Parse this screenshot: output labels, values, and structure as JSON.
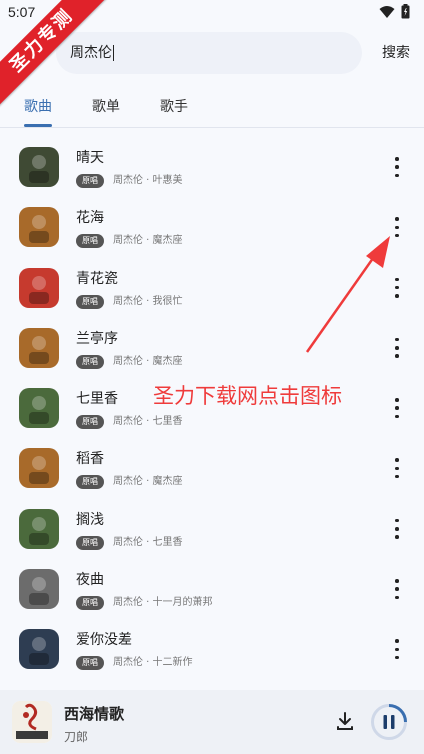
{
  "status": {
    "time": "5:07"
  },
  "watermark": {
    "ribbon": "圣力专测",
    "annotation": "圣力下载网点击图标"
  },
  "search": {
    "query": "周杰伦",
    "button": "搜索"
  },
  "tabs": [
    {
      "label": "歌曲",
      "active": true
    },
    {
      "label": "歌单",
      "active": false
    },
    {
      "label": "歌手",
      "active": false
    }
  ],
  "songs": [
    {
      "title": "晴天",
      "badge": "原唱",
      "artist": "周杰伦 · 叶惠美",
      "cover_color": "#3f4a34"
    },
    {
      "title": "花海",
      "badge": "原唱",
      "artist": "周杰伦 · 魔杰座",
      "cover_color": "#a86a2a"
    },
    {
      "title": "青花瓷",
      "badge": "原唱",
      "artist": "周杰伦 · 我很忙",
      "cover_color": "#c63a2e"
    },
    {
      "title": "兰亭序",
      "badge": "原唱",
      "artist": "周杰伦 · 魔杰座",
      "cover_color": "#a86a2a"
    },
    {
      "title": "七里香",
      "badge": "原唱",
      "artist": "周杰伦 · 七里香",
      "cover_color": "#4b6a3c"
    },
    {
      "title": "稻香",
      "badge": "原唱",
      "artist": "周杰伦 · 魔杰座",
      "cover_color": "#a86a2a"
    },
    {
      "title": "搁浅",
      "badge": "原唱",
      "artist": "周杰伦 · 七里香",
      "cover_color": "#4b6a3c"
    },
    {
      "title": "夜曲",
      "badge": "原唱",
      "artist": "周杰伦 · 十一月的萧邦",
      "cover_color": "#6c6c6c"
    },
    {
      "title": "爱你没差",
      "badge": "原唱",
      "artist": "周杰伦 · 十二新作",
      "cover_color": "#2e3d52"
    }
  ],
  "player": {
    "title": "西海情歌",
    "artist": "刀郎"
  }
}
